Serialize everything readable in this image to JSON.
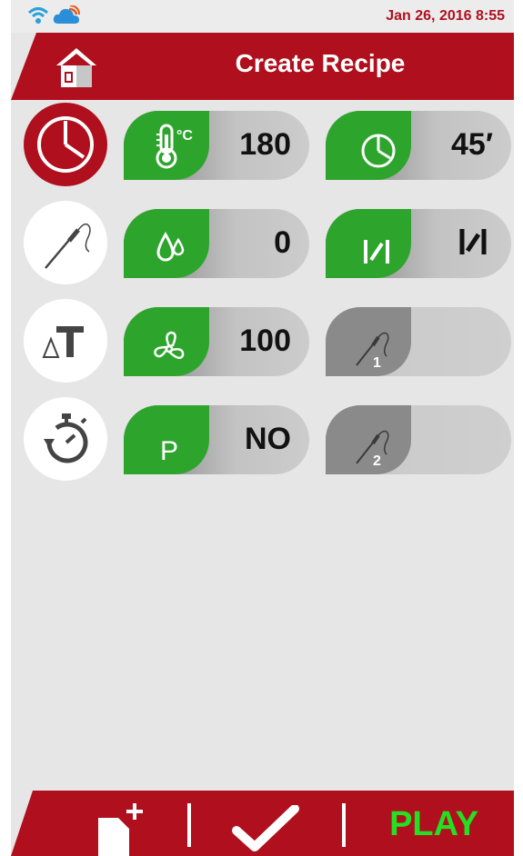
{
  "status": {
    "datetime": "Jan 26, 2016  8:55",
    "icons": [
      "wifi-icon",
      "cloud-icon"
    ]
  },
  "header": {
    "title": "Create Recipe",
    "home_icon": "home-icon"
  },
  "modes": [
    "clock-icon",
    "probe-icon",
    "delta-t-icon",
    "timer-icon"
  ],
  "params": {
    "temperature": {
      "value": "180",
      "icon": "thermometer-celsius-icon"
    },
    "time": {
      "value": "45′",
      "icon": "clock-icon"
    },
    "humidity": {
      "value": "0",
      "icon": "water-drop-icon"
    },
    "vent": {
      "value": "",
      "icon": "vent-icon"
    },
    "fan": {
      "value": "100",
      "icon": "fan-icon"
    },
    "probe1": {
      "value": "",
      "label": "1",
      "icon": "probe-icon"
    },
    "preheat": {
      "value": "NO",
      "label": "P",
      "icon": "preheat-icon"
    },
    "probe2": {
      "value": "",
      "label": "2",
      "icon": "probe-icon"
    }
  },
  "footer": {
    "new_icon": "new-document-icon",
    "save_icon": "checkmark-icon",
    "play_label": "PLAY"
  },
  "colors": {
    "brand_red": "#b0101e",
    "tab_green": "#2da52d",
    "play_green": "#23e023"
  }
}
